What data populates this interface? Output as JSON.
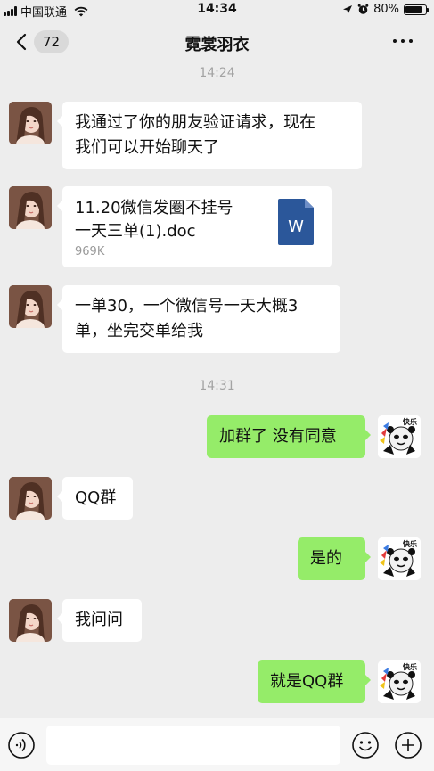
{
  "status_bar": {
    "carrier": "中国联通",
    "time": "14:34",
    "battery": "80%",
    "battery_level": 0.8
  },
  "nav": {
    "unread_count": "72",
    "title": "霓裳羽衣"
  },
  "messages": {
    "ts1": "14:24",
    "m1": "我通过了你的朋友验证请求，现在\n我们可以开始聊天了",
    "file": {
      "name": "11.20微信发圈不挂号 一天三单(1).doc",
      "size": "969K",
      "icon_letter": "W"
    },
    "m3": "一单30，一个微信号一天大概3\n单，坐完交单给我",
    "ts2": "14:31",
    "m4": "加群了 没有同意",
    "m5": "QQ群",
    "m6": "是的",
    "m7": "我问问",
    "m8": "就是QQ群",
    "panda_caption": "快乐"
  },
  "input": {
    "placeholder": ""
  },
  "colors": {
    "background": "#ededed",
    "bubble_out": "#95ec69",
    "bubble_in": "#ffffff",
    "word_icon": "#2b579a"
  }
}
